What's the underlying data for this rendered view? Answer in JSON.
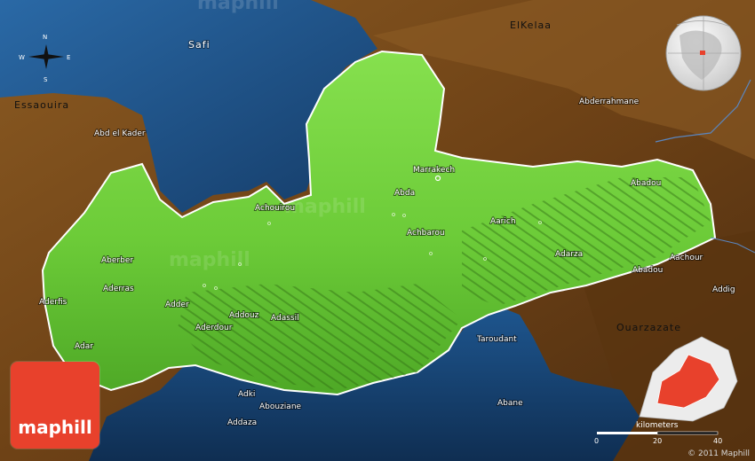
{
  "brand": {
    "name": "maphill",
    "watermark": "maphill",
    "copyright": "© 2011 Maphill"
  },
  "compass": {
    "north": "N",
    "south": "S",
    "east": "E",
    "west": "W"
  },
  "regions": {
    "safi": "Safi",
    "elkelaa": "ElKelaa",
    "essaouira": "Essaouira",
    "ouarzazate": "Ouarzazate",
    "taroudant": "Taroudant"
  },
  "places": {
    "abd_el_kader": "Abd el Kader",
    "abderrahmane": "Abderrahmane",
    "marrakech": "Marrakech",
    "abda": "Abda",
    "achouirou": "Achouirou",
    "achbarou": "Achbarou",
    "aarich": "Aarich",
    "abadou_1": "Abadou",
    "aberber": "Aberber",
    "aderras": "Aderras",
    "adarza": "Adarza",
    "aachour": "Aachour",
    "abadou_2": "Abadou",
    "aderfis": "Aderfis",
    "adder": "Adder",
    "addouz": "Addouz",
    "adassil": "Adassil",
    "adaouz": "Aderdour",
    "addig": "Addig",
    "adar": "Adar",
    "adki": "Adki",
    "abouziane": "Abouziane",
    "addaza": "Addaza",
    "abane": "Abane"
  },
  "scale": {
    "unit": "kilometers",
    "ticks": [
      "0",
      "20",
      "40"
    ]
  },
  "colors": {
    "land_green": "#6fcf3a",
    "land_green_dark": "#3f8f1c",
    "terrain_brown": "#7a4a1a",
    "water_blue": "#1d4f86",
    "logo_red": "#e8412c"
  }
}
